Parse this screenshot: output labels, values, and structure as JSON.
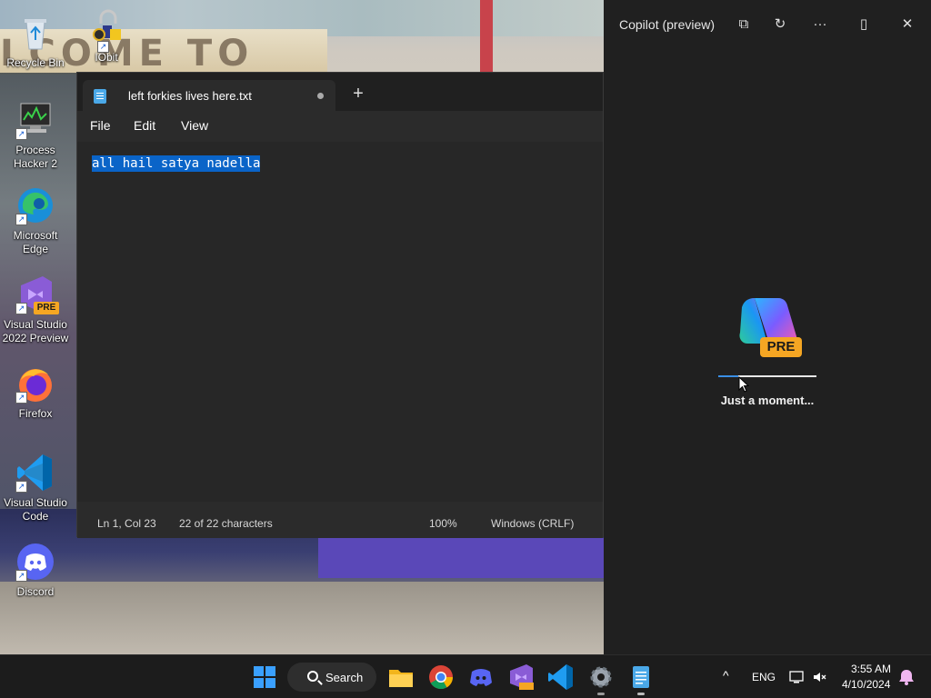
{
  "desktop": {
    "icons": [
      {
        "label": "Recycle Bin",
        "icon": "recycle-bin-icon"
      },
      {
        "label": "IObit",
        "icon": "iobit-unlocker-icon"
      },
      {
        "label": "Process Hacker 2",
        "icon": "process-hacker-icon"
      },
      {
        "label": "Microsoft Edge",
        "icon": "edge-icon"
      },
      {
        "label": "Visual Studio 2022 Preview",
        "icon": "visual-studio-preview-icon",
        "badge": "PRE"
      },
      {
        "label": "Firefox",
        "icon": "firefox-icon"
      },
      {
        "label": "Visual Studio Code",
        "icon": "vscode-icon"
      },
      {
        "label": "Discord",
        "icon": "discord-icon"
      }
    ],
    "wallpaper_text": "LCOME TO"
  },
  "notepad": {
    "tab_title": "left forkies lives here.txt",
    "tab_unsaved_indicator": "●",
    "new_tab": "+",
    "menu": {
      "file": "File",
      "edit": "Edit",
      "view": "View"
    },
    "content": "all hail satya nadella",
    "status": {
      "position": "Ln 1, Col 23",
      "characters": "22 of 22 characters",
      "zoom": "100%",
      "line_endings": "Windows (CRLF)"
    }
  },
  "copilot": {
    "title": "Copilot (preview)",
    "badge": "PRE",
    "loading_text": "Just a moment...",
    "progress": 0.2,
    "buttons": {
      "open_external": "⧉",
      "refresh": "↻",
      "more": "···",
      "dock": "▯",
      "close": "✕"
    }
  },
  "taskbar": {
    "search_label": "Search",
    "apps": [
      "start",
      "search",
      "file-explorer",
      "chrome",
      "discord",
      "visual-studio-preview",
      "vscode",
      "settings",
      "notepad"
    ],
    "tray": {
      "chevron": "^",
      "language": "ENG",
      "time": "3:55 AM",
      "date": "4/10/2024"
    }
  },
  "colors": {
    "accent": "#0a64c8",
    "window_bg": "#202020",
    "taskbar_bg": "#1c1c1c",
    "pre_badge": "#f5a623"
  }
}
